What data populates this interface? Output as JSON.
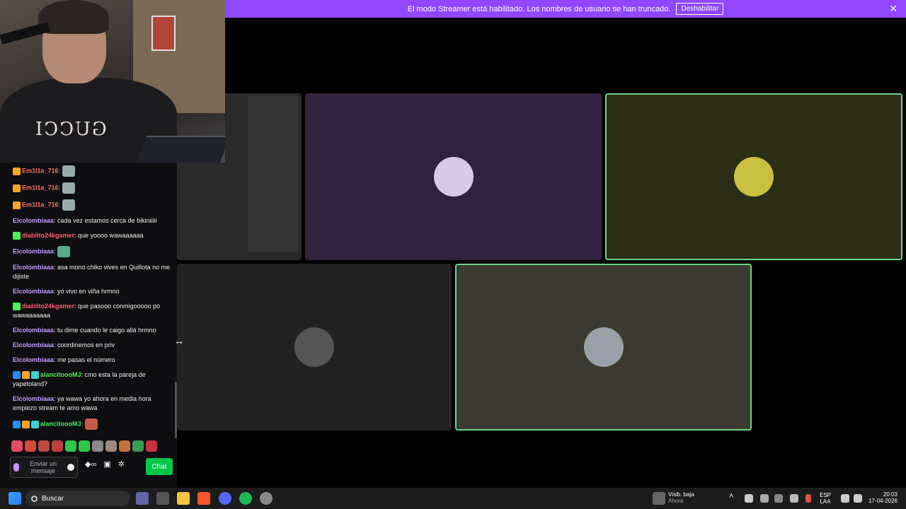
{
  "banner": {
    "text": "El modo Streamer está habilitado. Los nombres de usuario se han truncado.",
    "button": "Deshabilitar",
    "close": "✕"
  },
  "colors": {
    "banner": "#9147ff",
    "speaking_border": "#6bd48a",
    "chat_button": "#00c74a",
    "username_purple": "#c49cff",
    "username_red": "#ff5c6c",
    "username_green": "#4ef05a"
  },
  "webcam": {
    "shirt_text": "GUCCI"
  },
  "chat": {
    "messages": [
      {
        "user": "Em1l1a_716",
        "color": "#ff6b6b",
        "badges": [
          "#f5a623"
        ],
        "text": "",
        "emote": "#9aa"
      },
      {
        "user": "Em1l1a_716",
        "color": "#ff6b6b",
        "badges": [
          "#f5a623"
        ],
        "text": "",
        "emote": "#9aa"
      },
      {
        "user": "Em1l1a_716",
        "color": "#ff6b6b",
        "badges": [
          "#f5a623"
        ],
        "text": "",
        "emote": "#9aa"
      },
      {
        "user": "Elcolombiaaa",
        "color": "#c49cff",
        "badges": [],
        "text": "cada vez estamos cerca de bikiniiiii"
      },
      {
        "user": "diablito24kgamer",
        "color": "#ff5c6c",
        "badges": [
          "#4ef05a"
        ],
        "text": "que yoooo wawaaaaaa"
      },
      {
        "user": "Elcolombiaaa",
        "color": "#c49cff",
        "badges": [],
        "text": "",
        "emote": "#5a8"
      },
      {
        "user": "Elcolombiaaa",
        "color": "#c49cff",
        "badges": [],
        "text": "asa mono chiko vives en Quillota no me dijiste"
      },
      {
        "user": "Elcolombiaaa",
        "color": "#c49cff",
        "badges": [],
        "text": "yo vivo en viña hrmno"
      },
      {
        "user": "diablito24kgamer",
        "color": "#ff5c6c",
        "badges": [
          "#4ef05a"
        ],
        "text": "que pasooo conmigooooo po wawaaaaaaa"
      },
      {
        "user": "Elcolombiaaa",
        "color": "#c49cff",
        "badges": [],
        "text": "tu dime cuando le caigo allá hrmno"
      },
      {
        "user": "Elcolombiaaa",
        "color": "#c49cff",
        "badges": [],
        "text": "coordinemos en priv"
      },
      {
        "user": "Elcolombiaaa",
        "color": "#c49cff",
        "badges": [],
        "text": "me pasas el número"
      },
      {
        "user": "alancitoooMJ",
        "color": "#4ef05a",
        "badges": [
          "#1e90ff",
          "#f5a623",
          "#3bd1d1"
        ],
        "text": "cmo esta la pareja de yapetoland?"
      },
      {
        "user": "Elcolombiaaa",
        "color": "#c49cff",
        "badges": [],
        "text": "ya wawa yo ahora en media hora empiezo stream te amo wawa"
      },
      {
        "user": "alancitoooMJ",
        "color": "#4ef05a",
        "badges": [
          "#1e90ff",
          "#f5a623",
          "#3bd1d1"
        ],
        "text": "",
        "emote": "#c45a4a"
      },
      {
        "user": "alancitoooMJ",
        "color": "#4ef05a",
        "badges": [
          "#1e90ff",
          "#f5a623",
          "#3bd1d1"
        ],
        "text": "",
        "emote": "#c45a4a"
      }
    ],
    "emote_bar": [
      "#e64a6a",
      "#d44a3a",
      "#b84a44",
      "#c04040",
      "#2dc84a",
      "#2dc84a",
      "#8a8a8a",
      "#9a8a80",
      "#c87040",
      "#3a9a5a",
      "#c83040"
    ],
    "input_placeholder": "Enviar un mensaje",
    "send_button": "Chat"
  },
  "tiles": [
    {
      "kind": "screenshare",
      "bg": "#2a2a2a"
    },
    {
      "kind": "avatar",
      "bg": "#31213f",
      "avatar": "#d8c9e8",
      "speaking": false
    },
    {
      "kind": "avatar",
      "bg": "#2b2d17",
      "avatar": "#c8c040",
      "speaking": true
    },
    {
      "kind": "avatar",
      "bg": "#222222",
      "avatar": "#555",
      "speaking": false
    },
    {
      "kind": "avatar",
      "bg": "#3a3a30",
      "avatar": "#9aa0a8",
      "speaking": true
    }
  ],
  "taskbar": {
    "search_label": "Buscar",
    "notif_title": "Visib. baja",
    "notif_sub": "Ahora",
    "lang_top": "ESP",
    "lang_bottom": "LAA",
    "time": "20:03",
    "date": "17-04-2026"
  }
}
